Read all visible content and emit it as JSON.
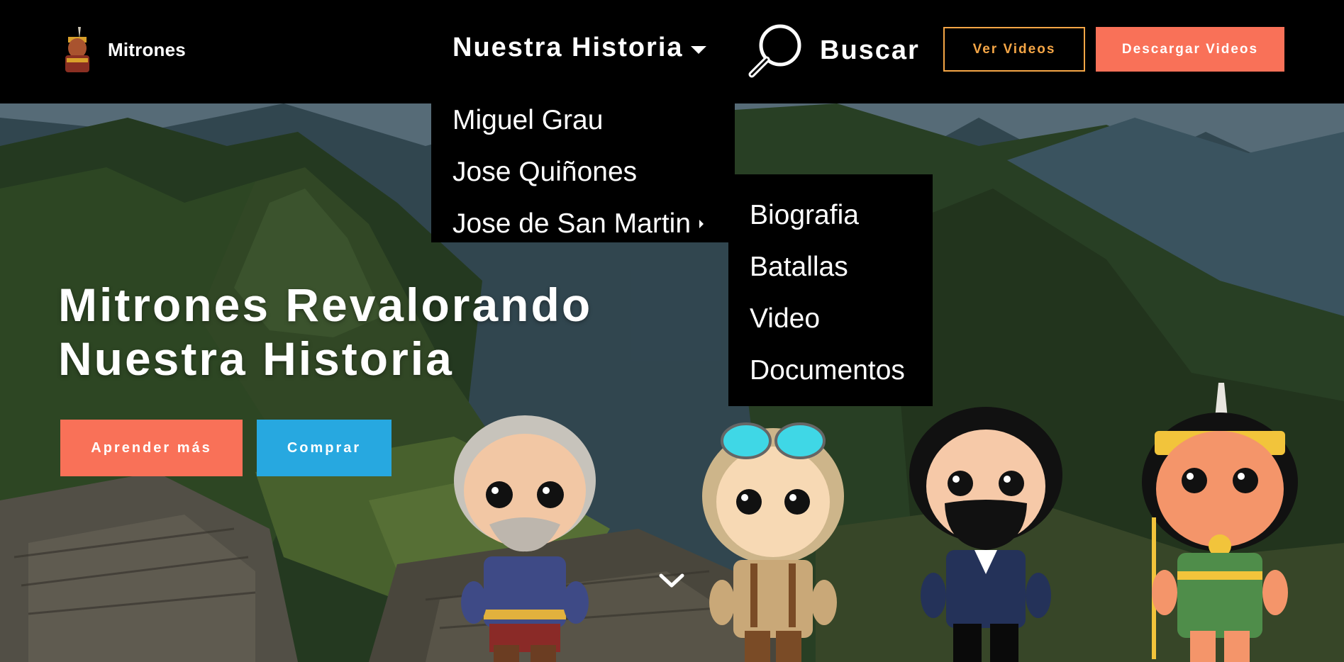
{
  "header": {
    "brand_name": "Mitrones",
    "nav_label": "Nuestra Historia",
    "search_label": "Buscar",
    "watch_button": "Ver Videos",
    "download_button": "Descargar Videos"
  },
  "dropdown": {
    "items": [
      "Miguel Grau",
      "Jose Quiñones",
      "Jose de San Martin"
    ]
  },
  "submenu": {
    "items": [
      "Biografia",
      "Batallas",
      "Video",
      "Documentos"
    ]
  },
  "hero": {
    "headline_line1": "Mitrones Revalorando",
    "headline_line2": "Nuestra Historia",
    "learn_button": "Aprender más",
    "buy_button": "Comprar"
  },
  "colors": {
    "accent_coral": "#f97158",
    "accent_orange": "#f5a646",
    "accent_blue": "#27a8e0",
    "header_bg": "#000000"
  },
  "icons": [
    "logo-icon",
    "chevron-down-icon",
    "search-icon",
    "chevron-right-icon",
    "scroll-down-icon"
  ]
}
